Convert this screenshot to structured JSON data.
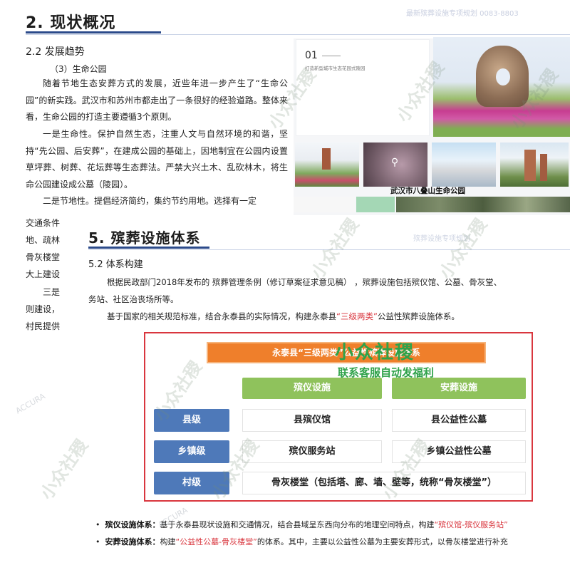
{
  "back_page": {
    "top_tag": "最新殡葬设施专项规划 0083-8803",
    "section_title": "2.  现状概况",
    "sub_section": "2.2 发展趋势",
    "sub_item": "（3）生命公园",
    "paragraphs": [
      "随着节地生态安葬方式的发展，近些年进一步产生了“生命公园”的新实践。武汉市和苏州市都走出了一条很好的经验道路。整体来看，生命公园的打造主要遵循3个原则。",
      "一是生命性。保护自然生态，注重人文与自然环境的和谐，坚持“先公园、后安葬”，在建成公园的基础上，因地制宜在公园内设置草坪葬、树葬、花坛葬等生态葬法。严禁大兴土木、乱砍林木，将生命公园建设成公墓（陵园）。",
      "二是节地性。提倡经济简约，集约节约用地。选择有一定"
    ],
    "continuation": [
      "交通条件",
      "地、疏林",
      "骨灰楼堂",
      "大上建设",
      "三是",
      "则建设，",
      "村民提供"
    ],
    "card_number": "01",
    "card_caption": "打造新型城市生态花园式陵园",
    "photo_caption": "武汉市八叠山生命公园"
  },
  "front_page": {
    "top_tag": "殡葬设施专项规划",
    "section_title": "5.  殡葬设施体系",
    "sub_section": "5.2 体系构建",
    "p1_line1": "根据民政部门2018年发布的  殡葬管理条例（修订草案征求意见稿）  ，殡葬设施包括殡仪馆、公墓、骨灰堂、",
    "p1_line2": "务站、社区治丧场所等。",
    "p2_prefix": "基于国家的相关规范标准，结合永泰县的实际情况，构建永泰县",
    "p2_red": "“三级两类”",
    "p2_suffix": "公益性殡葬设施体系。",
    "diagram": {
      "header": "永泰县“三级两类”公益性殡葬设施体系",
      "col_heads": [
        "殡仪设施",
        "安葬设施"
      ],
      "rows": [
        {
          "label": "县级",
          "left": "县殡仪馆",
          "right": "县公益性公墓"
        },
        {
          "label": "乡镇级",
          "left": "殡仪服务站",
          "right": "乡镇公益性公墓"
        },
        {
          "label": "村级",
          "wide": "骨灰楼堂（包括塔、廊、墙、壁等，统称“骨灰楼堂”）"
        }
      ]
    },
    "bullets": [
      {
        "title": "殡仪设施体系：",
        "text": "基于永泰县现状设施和交通情况，结合县域呈东西向分布的地理空间特点，构建",
        "red": "“殡仪馆-殡仪服务站”"
      },
      {
        "title": "安葬设施体系：",
        "text_a": "构建",
        "red": "“公益性公墓-骨灰楼堂”",
        "text_b": "的体系。其中，主要以公益性公墓为主要安葬形式，以骨灰楼堂进行补充"
      }
    ]
  },
  "watermark": {
    "main": "小众社稷",
    "sub": "联系客服自动发福利",
    "small": "ACCURA"
  },
  "colors": {
    "accent_blue": "#4e79b9",
    "header_orange": "#ef7f2b",
    "col_green": "#8fc25c",
    "frame_red": "#d9363e",
    "watermark_green": "#2fa24a"
  }
}
